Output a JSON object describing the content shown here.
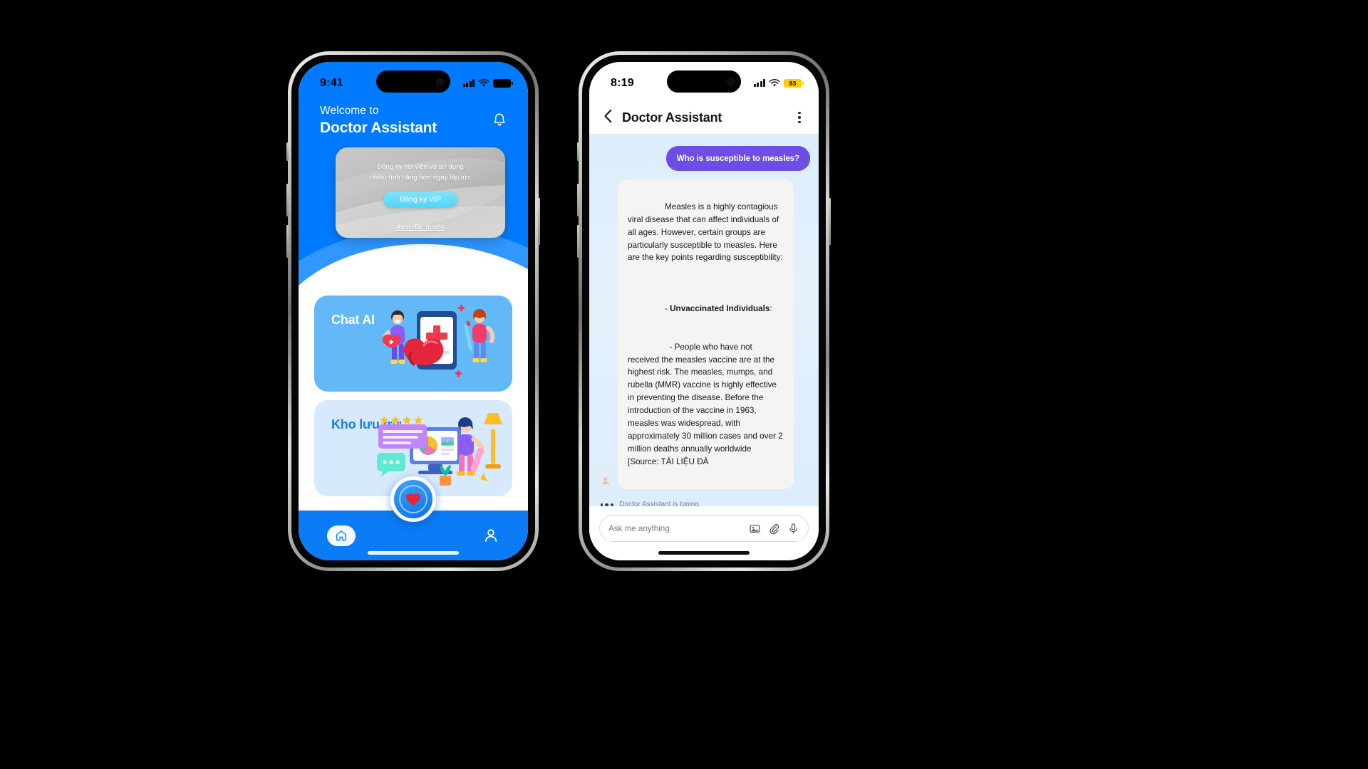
{
  "left_phone": {
    "status": {
      "time": "9:41",
      "signal_icon": "cellular-bars-icon",
      "wifi_icon": "wifi-icon",
      "battery_icon": "battery-full-icon"
    },
    "header": {
      "welcome_small": "Welcome to",
      "welcome_large": "Doctor Assistant",
      "bell_icon": "bell-icon"
    },
    "vip_card": {
      "description_line1": "Đăng ký hội viên và sử dụng",
      "description_line2": "nhiều tính năng hơn ngay lập tức",
      "button_label": "Đăng ký VIP",
      "link_label": "Xem đặc quyền"
    },
    "feature_cards": [
      {
        "title": "Chat AI",
        "name": "chat-ai-card",
        "art": "doctor-illustration"
      },
      {
        "title": "Kho lưu trữ",
        "name": "storage-card",
        "art": "archive-illustration"
      }
    ],
    "fab": {
      "icon": "heart-icon"
    },
    "tabbar": {
      "items": [
        {
          "icon": "home-icon",
          "name": "tab-home",
          "active": true
        },
        {
          "icon": "person-icon",
          "name": "tab-profile",
          "active": false
        }
      ]
    }
  },
  "right_phone": {
    "status": {
      "time": "8:19",
      "signal_icon": "cellular-bars-icon",
      "wifi_icon": "wifi-icon",
      "battery_percent": "83"
    },
    "header": {
      "back_icon": "chevron-left-icon",
      "title": "Doctor Assistant",
      "menu_icon": "kebab-menu-icon"
    },
    "messages": [
      {
        "role": "user",
        "text": "Who is susceptible to measles?"
      },
      {
        "role": "assistant",
        "avatar_icon": "person-avatar-icon",
        "paragraph1": "Measles is a highly contagious viral disease that can affect individuals of all ages. However, certain groups are particularly susceptible to measles. Here are the key points regarding susceptibility:",
        "bullet_prefix": "- ",
        "bullet_bold": "Unvaccinated Individuals",
        "bullet_suffix": ":",
        "paragraph2": "  - People who have not received the measles vaccine are at the highest risk. The measles, mumps, and rubella (MMR) vaccine is highly effective in preventing the disease. Before the introduction of the vaccine in 1963, measles was widespread, with approximately 30 million cases and over 2 million deaths annually worldwide [Source: TÀI LIỆU ĐÀ"
      }
    ],
    "typing_indicator": {
      "text": "Doctor Assistant is typing"
    },
    "input_bar": {
      "placeholder": "Ask me anything",
      "image_icon": "image-icon",
      "attach_icon": "paperclip-icon",
      "mic_icon": "microphone-icon"
    }
  },
  "colors": {
    "brand_blue": "#007bff",
    "tab_blue": "#0b7cf5",
    "chat_card_blue": "#63b8f8",
    "store_card_blue": "#d6e9fd",
    "user_bubble_purple": "#6c4de6",
    "bot_bubble_gray": "#f4f4f3",
    "chat_bg": "#ddeefb",
    "battery_yellow": "#ffcc00"
  }
}
